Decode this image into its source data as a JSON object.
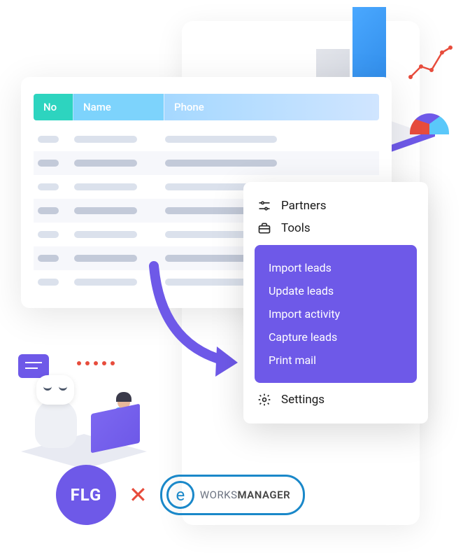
{
  "table": {
    "headers": {
      "no": "No",
      "name": "Name",
      "phone": "Phone"
    }
  },
  "menu": {
    "partners": "Partners",
    "tools": "Tools",
    "settings": "Settings",
    "submenu": {
      "import_leads": "Import leads",
      "update_leads": "Update leads",
      "import_activity": "Import activity",
      "capture_leads": "Capture leads",
      "print_mail": "Print mail"
    }
  },
  "logos": {
    "flg": "FLG",
    "separator": "✕",
    "eworks_prefix": "WORKS",
    "eworks_suffix": "MANAGER",
    "eworks_letter": "e"
  },
  "colors": {
    "primary": "#6e59e8",
    "teal": "#2dd4bf",
    "blue": "#4aa8ff",
    "red": "#e74c3c"
  }
}
